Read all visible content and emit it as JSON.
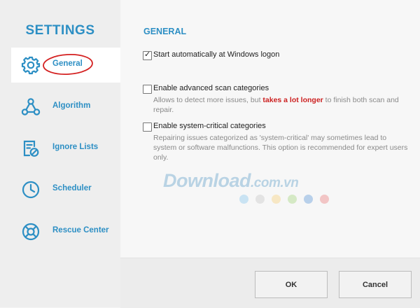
{
  "sidebar": {
    "title": "SETTINGS",
    "items": [
      {
        "label": "General",
        "icon": "gear-icon"
      },
      {
        "label": "Algorithm",
        "icon": "algorithm-icon"
      },
      {
        "label": "Ignore Lists",
        "icon": "ignore-list-icon"
      },
      {
        "label": "Scheduler",
        "icon": "clock-icon"
      },
      {
        "label": "Rescue Center",
        "icon": "lifebuoy-icon"
      }
    ],
    "active": "General"
  },
  "main": {
    "section_title": "GENERAL",
    "options": [
      {
        "label": "Start automatically at Windows logon",
        "checked": true
      },
      {
        "label": "Enable advanced scan categories",
        "checked": false,
        "desc_before": "Allows to detect more issues, but ",
        "desc_highlight": "takes a lot longer",
        "desc_after": " to finish both scan and repair."
      },
      {
        "label": "Enable system-critical categories",
        "checked": false,
        "desc": "Repairing issues categorized as 'system-critical' may sometimes lead to system or software malfunctions. This option is recommended for expert users only."
      }
    ]
  },
  "footer": {
    "ok_label": "OK",
    "cancel_label": "Cancel"
  },
  "watermark": {
    "text": "Download",
    "suffix": ".com.vn",
    "dot_colors": [
      "#c9e3f3",
      "#e3e3e3",
      "#f7e7c4",
      "#d5e9c5",
      "#b8d0ea",
      "#f2c5c5"
    ]
  },
  "colors": {
    "accent": "#2d8fc4",
    "warning": "#cc1f1f",
    "annotation": "#d42020"
  }
}
